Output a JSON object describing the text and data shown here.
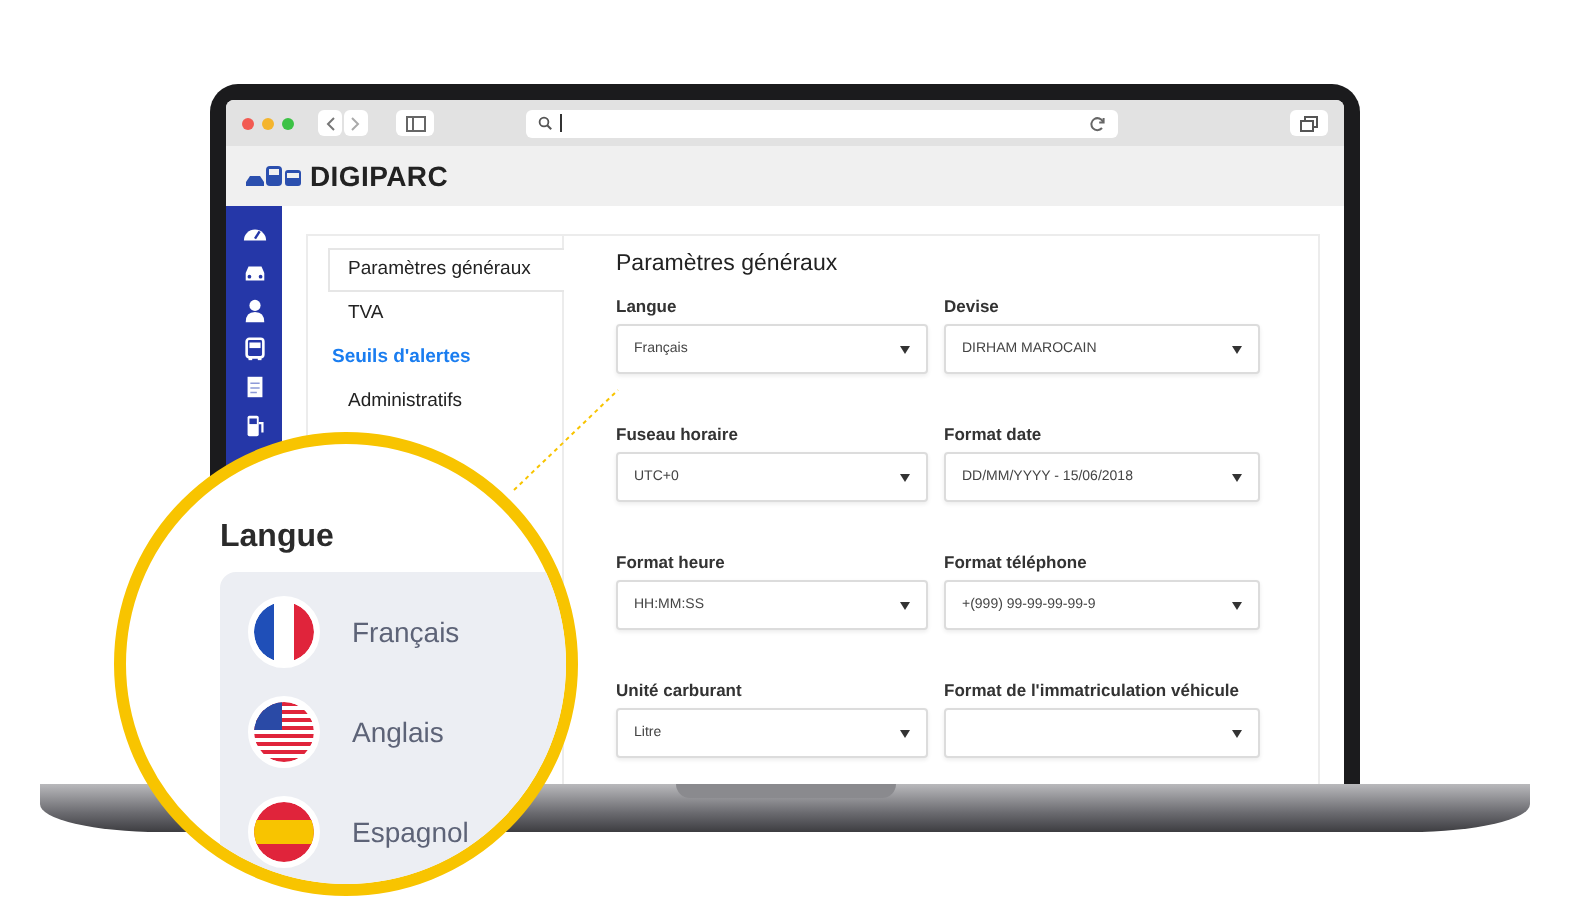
{
  "app": {
    "logo": "DIGIPARC"
  },
  "menu": [
    {
      "label": "Paramètres généraux",
      "selected": true,
      "hovered": false
    },
    {
      "label": "TVA",
      "selected": false,
      "hovered": false
    },
    {
      "label": "Seuils d'alertes",
      "selected": false,
      "hovered": true
    },
    {
      "label": "Administratifs",
      "selected": false,
      "hovered": false
    }
  ],
  "form": {
    "title": "Paramètres généraux",
    "fields": [
      {
        "label": "Langue",
        "value": "Français"
      },
      {
        "label": "Devise",
        "value": "DIRHAM MAROCAIN"
      },
      {
        "label": "Fuseau horaire",
        "value": "UTC+0"
      },
      {
        "label": "Format date",
        "value": "DD/MM/YYYY - 15/06/2018"
      },
      {
        "label": "Format heure",
        "value": "HH:MM:SS"
      },
      {
        "label": "Format téléphone",
        "value": "+(999) 99-99-99-99-9"
      },
      {
        "label": "Unité carburant",
        "value": "Litre"
      },
      {
        "label": "Format de l'immatriculation véhicule"
      }
    ]
  },
  "magnifier": {
    "title": "Langue",
    "options": [
      {
        "label": "Français",
        "kind": "france"
      },
      {
        "label": "Anglais",
        "kind": "usa"
      },
      {
        "label": "Espagnol",
        "kind": "spain"
      }
    ]
  }
}
